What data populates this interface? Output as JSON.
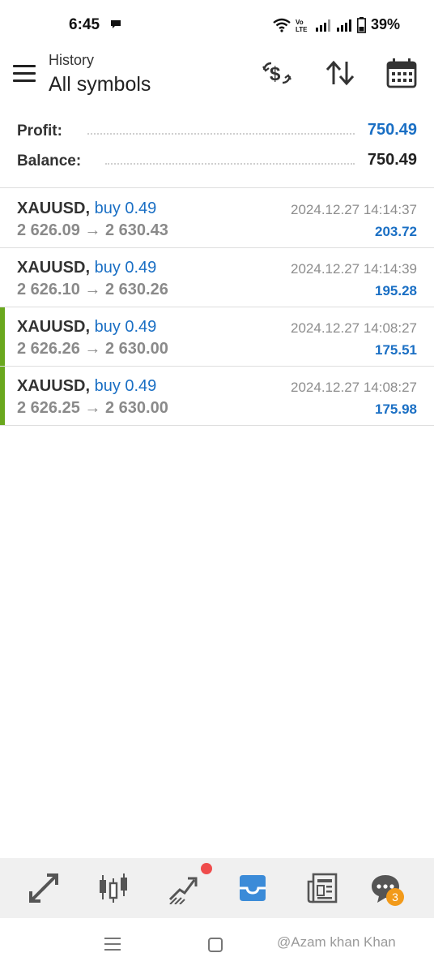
{
  "status_bar": {
    "time": "6:45",
    "battery": "39%",
    "icons": [
      "message-icon",
      "wifi-icon",
      "volte-icon",
      "signal-icon",
      "signal-icon",
      "battery-icon"
    ]
  },
  "header": {
    "subtitle": "History",
    "title": "All symbols",
    "actions": [
      "currency-exchange-icon",
      "sort-icon",
      "calendar-icon"
    ]
  },
  "summary": {
    "profit_label": "Profit:",
    "profit_value": "750.49",
    "balance_label": "Balance:",
    "balance_value": "750.49"
  },
  "trades": [
    {
      "symbol": "XAUUSD,",
      "type": "buy 0.49",
      "prices": "2 626.09 → 2 630.43",
      "time": "2024.12.27 14:14:37",
      "profit": "203.72",
      "marked": false
    },
    {
      "symbol": "XAUUSD,",
      "type": "buy 0.49",
      "prices": "2 626.10 → 2 630.26",
      "time": "2024.12.27 14:14:39",
      "profit": "195.28",
      "marked": false
    },
    {
      "symbol": "XAUUSD,",
      "type": "buy 0.49",
      "prices": "2 626.26 → 2 630.00",
      "time": "2024.12.27 14:08:27",
      "profit": "175.51",
      "marked": true
    },
    {
      "symbol": "XAUUSD,",
      "type": "buy 0.49",
      "prices": "2 626.25 → 2 630.00",
      "time": "2024.12.27 14:08:27",
      "profit": "175.98",
      "marked": true
    }
  ],
  "bottom_nav": {
    "items": [
      "quotes-icon",
      "chart-icon",
      "trade-icon",
      "history-icon",
      "news-icon",
      "messages-icon"
    ],
    "active": "history-icon",
    "messages_badge": "3"
  },
  "watermark": "@Azam khan Khan",
  "colors": {
    "accent": "#1a6fc4",
    "marker": "#6aa81e",
    "badge": "#f29a1a",
    "notification": "#ef4c4c"
  }
}
